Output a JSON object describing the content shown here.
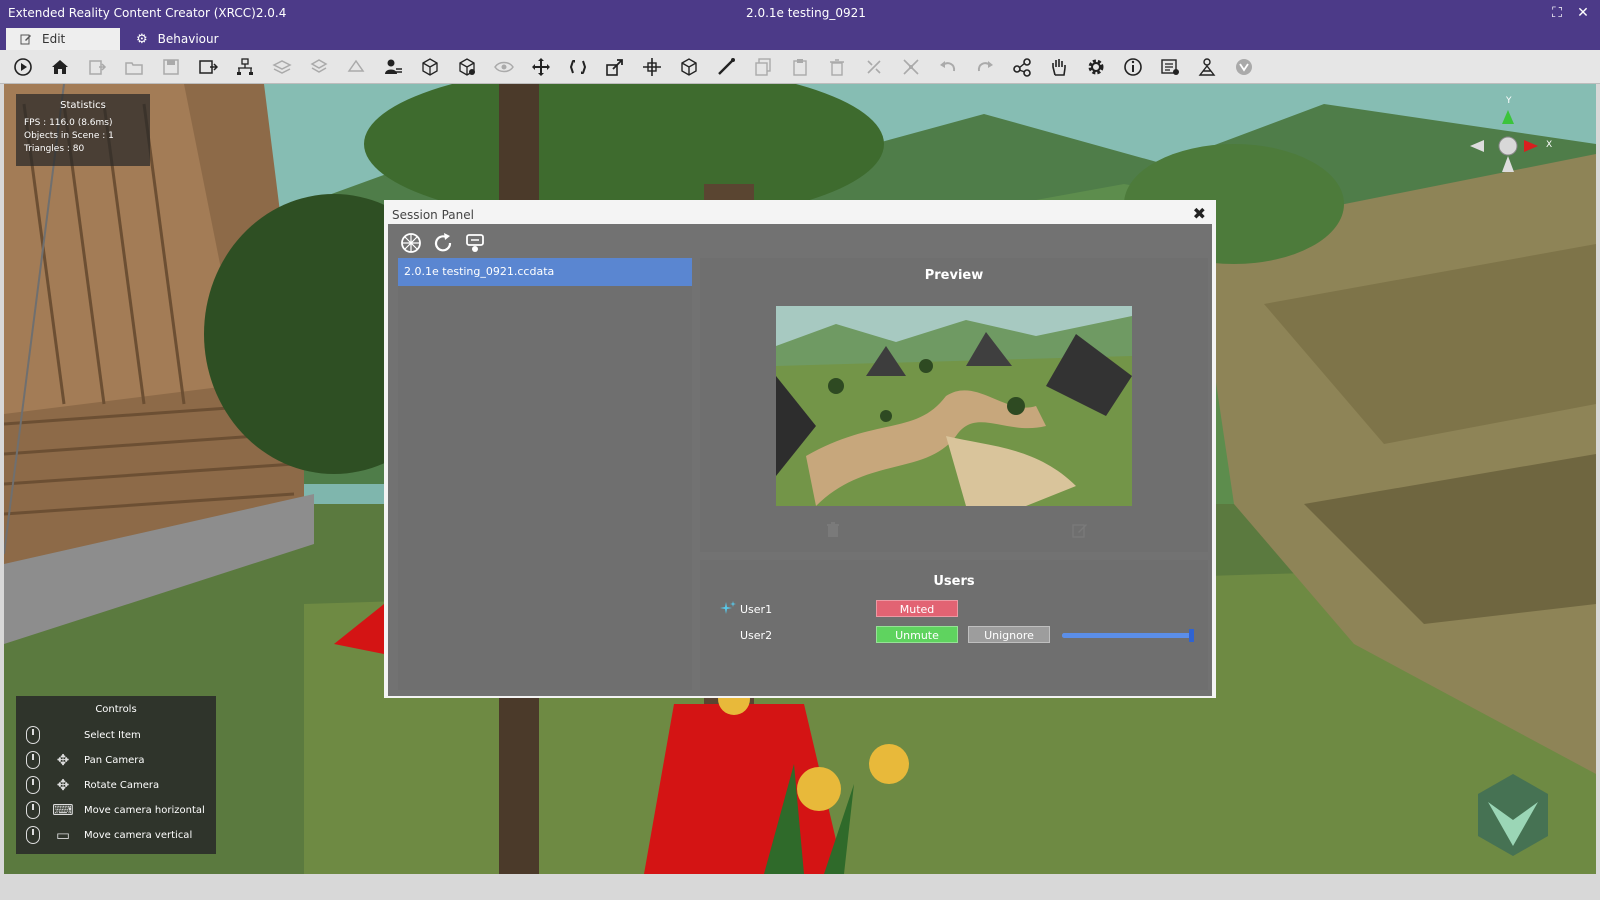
{
  "window": {
    "app_title": "Extended Reality Content Creator (XRCC)2.0.4",
    "doc_title": "2.0.1e testing_0921",
    "maximize_glyph": "⛶",
    "close_glyph": "✕"
  },
  "tabs": [
    {
      "label": "Edit",
      "icon": "edit-icon",
      "active": true
    },
    {
      "label": "Behaviour",
      "icon": "gear-icon",
      "active": false
    }
  ],
  "toolbar": {
    "tools": [
      "play-icon",
      "home-icon",
      "import-icon",
      "open-icon",
      "save-icon",
      "save-as-icon",
      "hierarchy-icon",
      "layers-icon",
      "stack-icon",
      "export-icon",
      "user-edit-icon",
      "box-icon",
      "box-add-icon",
      "eye-icon",
      "move-icon",
      "rotate-icon",
      "scale-icon",
      "pivot-icon",
      "cube-icon",
      "measure-icon",
      "copy-icon",
      "paste-icon",
      "delete-icon",
      "snap-icon",
      "group-icon",
      "undo-icon",
      "redo-icon",
      "share-icon",
      "hand-icon",
      "settings-icon",
      "info-icon",
      "log-icon",
      "network-icon",
      "help-icon"
    ]
  },
  "stats": {
    "heading": "Statistics",
    "fps": "FPS : 116.0 (8.6ms)",
    "objects": "Objects in Scene : 1",
    "triangles": "Triangles : 80"
  },
  "controls": {
    "heading": "Controls",
    "rows": [
      {
        "label": "Select Item",
        "glyph": ""
      },
      {
        "label": "Pan Camera",
        "glyph": "✥"
      },
      {
        "label": "Rotate Camera",
        "glyph": "✥"
      },
      {
        "label": "Move camera horizontal",
        "glyph": "⌨"
      },
      {
        "label": "Move camera vertical",
        "glyph": "▭"
      }
    ]
  },
  "gizmo": {
    "y_label": "Y",
    "x_label": "X"
  },
  "session_panel": {
    "title": "Session Panel",
    "close_glyph": "✖",
    "tools": [
      "connect-icon",
      "refresh-icon",
      "host-icon"
    ],
    "files": [
      "2.0.1e testing_0921.ccdata"
    ],
    "preview_heading": "Preview",
    "users_heading": "Users",
    "users": [
      {
        "name": "User1",
        "is_host": true,
        "mute_label": "Muted"
      },
      {
        "name": "User2",
        "is_host": false,
        "mute_label": "Unmute",
        "ignore_label": "Unignore",
        "volume": 1.0
      }
    ]
  },
  "colors": {
    "title_bar": "#4c3a88",
    "selected_file": "#5a86d1",
    "muted": "#e26373",
    "unmute": "#5fd35f",
    "slider": "#5b8ee8"
  }
}
